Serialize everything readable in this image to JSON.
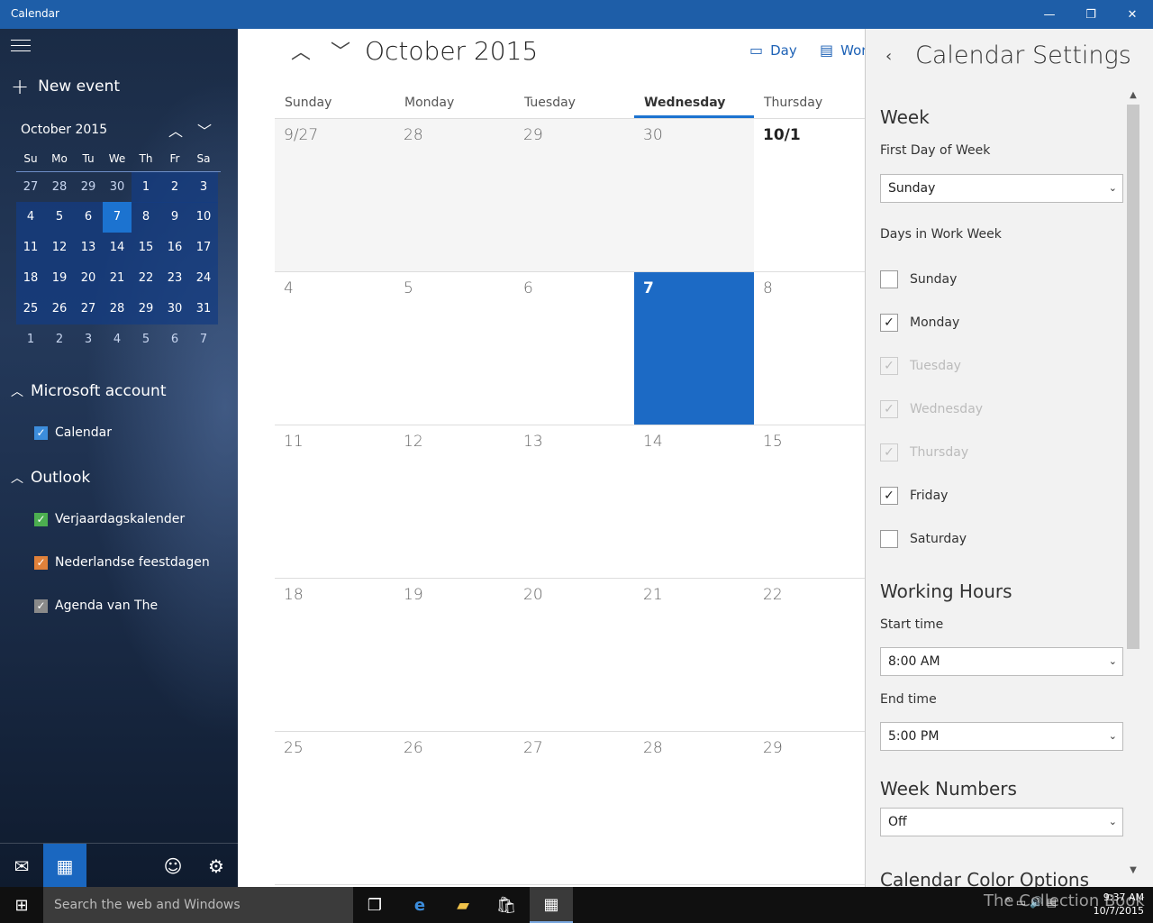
{
  "window": {
    "title": "Calendar",
    "minimize": "—",
    "restore": "❐",
    "close": "✕"
  },
  "sidebar": {
    "new_event": "New event",
    "mini_calendar": {
      "title": "October 2015",
      "weekdays": [
        "Su",
        "Mo",
        "Tu",
        "We",
        "Th",
        "Fr",
        "Sa"
      ],
      "weeks": [
        [
          "27",
          "28",
          "29",
          "30",
          "1",
          "2",
          "3"
        ],
        [
          "4",
          "5",
          "6",
          "7",
          "8",
          "9",
          "10"
        ],
        [
          "11",
          "12",
          "13",
          "14",
          "15",
          "16",
          "17"
        ],
        [
          "18",
          "19",
          "20",
          "21",
          "22",
          "23",
          "24"
        ],
        [
          "25",
          "26",
          "27",
          "28",
          "29",
          "30",
          "31"
        ],
        [
          "1",
          "2",
          "3",
          "4",
          "5",
          "6",
          "7"
        ]
      ],
      "selected": "7"
    },
    "accounts": [
      {
        "name": "Microsoft account",
        "calendars": [
          {
            "name": "Calendar",
            "color": "#3c8ddc"
          }
        ]
      },
      {
        "name": "Outlook",
        "calendars": [
          {
            "name": "Verjaardagskalender",
            "color": "#4caf50"
          },
          {
            "name": "Nederlandse feestdagen",
            "color": "#e0813a"
          },
          {
            "name": "Agenda van The",
            "color": "#8a8a8a"
          }
        ]
      }
    ]
  },
  "main": {
    "month_title": "October 2015",
    "views": {
      "day": "Day",
      "work_week": "Wor"
    },
    "weekdays": [
      "Sunday",
      "Monday",
      "Tuesday",
      "Wednesday",
      "Thursday"
    ],
    "today_column": "Wednesday",
    "weeks": [
      [
        "9/27",
        "28",
        "29",
        "30",
        "10/1"
      ],
      [
        "4",
        "5",
        "6",
        "7",
        "8"
      ],
      [
        "11",
        "12",
        "13",
        "14",
        "15"
      ],
      [
        "18",
        "19",
        "20",
        "21",
        "22"
      ],
      [
        "25",
        "26",
        "27",
        "28",
        "29"
      ]
    ],
    "today": "7",
    "accent": "#1c6ac5"
  },
  "settings": {
    "title": "Calendar Settings",
    "week_heading": "Week",
    "first_day_label": "First Day of Week",
    "first_day_value": "Sunday",
    "work_week_label": "Days in Work Week",
    "work_days": [
      {
        "day": "Sunday",
        "checked": false,
        "disabled": false
      },
      {
        "day": "Monday",
        "checked": true,
        "disabled": false
      },
      {
        "day": "Tuesday",
        "checked": true,
        "disabled": true
      },
      {
        "day": "Wednesday",
        "checked": true,
        "disabled": true
      },
      {
        "day": "Thursday",
        "checked": true,
        "disabled": true
      },
      {
        "day": "Friday",
        "checked": true,
        "disabled": false
      },
      {
        "day": "Saturday",
        "checked": false,
        "disabled": false
      }
    ],
    "working_hours_heading": "Working Hours",
    "start_time_label": "Start time",
    "start_time_value": "8:00 AM",
    "end_time_label": "End time",
    "end_time_value": "5:00 PM",
    "week_numbers_heading": "Week Numbers",
    "week_numbers_value": "Off",
    "color_options_heading": "Calendar Color Options"
  },
  "taskbar": {
    "search_placeholder": "Search the web and Windows",
    "watermark": "The Collection Book",
    "time": "9:37 AM",
    "date": "10/7/2015"
  }
}
